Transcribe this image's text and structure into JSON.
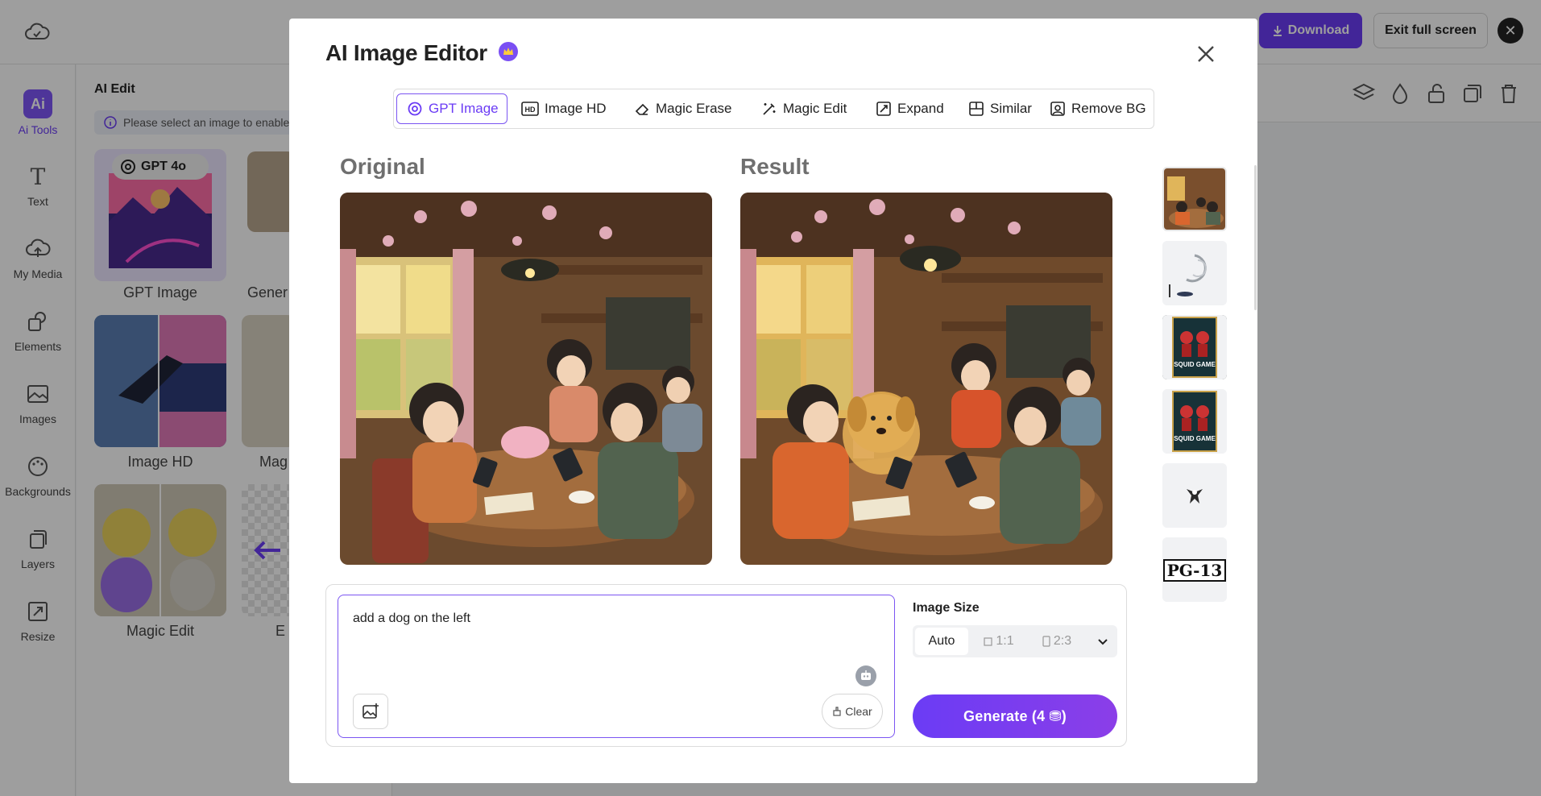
{
  "topbar": {
    "download_label": "Download",
    "exit_label": "Exit full screen"
  },
  "leftnav": {
    "items": [
      {
        "label": "Ai Tools",
        "icon": "ai-tools-icon",
        "active": true
      },
      {
        "label": "Text",
        "icon": "text-icon"
      },
      {
        "label": "My Media",
        "icon": "upload-cloud-icon"
      },
      {
        "label": "Elements",
        "icon": "elements-icon"
      },
      {
        "label": "Images",
        "icon": "image-icon"
      },
      {
        "label": "Backgrounds",
        "icon": "palette-icon"
      },
      {
        "label": "Layers",
        "icon": "layers-icon"
      },
      {
        "label": "Resize",
        "icon": "resize-icon"
      }
    ],
    "ai_badge": "Ai"
  },
  "panel": {
    "title": "AI Edit",
    "info": "Please select an image to enable",
    "gpt_badge": "GPT 4o",
    "tools": [
      {
        "label": "GPT Image"
      },
      {
        "label": "Gener"
      },
      {
        "label": "Image HD"
      },
      {
        "label": "Mag"
      },
      {
        "label": "Magic Edit"
      },
      {
        "label": "E"
      }
    ]
  },
  "modal": {
    "title": "AI Image Editor",
    "tabs": [
      {
        "label": "GPT Image",
        "icon": "openai-icon",
        "active": true
      },
      {
        "label": "Image HD",
        "icon": "hd-icon"
      },
      {
        "label": "Magic Erase",
        "icon": "eraser-icon"
      },
      {
        "label": "Magic Edit",
        "icon": "magic-wand-icon"
      },
      {
        "label": "Expand",
        "icon": "expand-icon"
      },
      {
        "label": "Similar",
        "icon": "similar-icon"
      },
      {
        "label": "Remove BG",
        "icon": "remove-bg-icon"
      }
    ],
    "original_title": "Original",
    "result_title": "Result",
    "thumbnails": [
      "cafe-scene",
      "abstract-sketch",
      "squid-game-poster",
      "squid-game-poster",
      "small-figure",
      "pg-13-logo"
    ],
    "pg13_text": "PG-13",
    "squid_text": "SQUID GAME",
    "prompt": {
      "value": "add a dog on the left"
    },
    "clear_label": "Clear",
    "image_size_label": "Image Size",
    "sizes": [
      {
        "label": "Auto",
        "active": true
      },
      {
        "label": "1:1"
      },
      {
        "label": "2:3"
      }
    ],
    "generate_label": "Generate  (4 ⛃)"
  },
  "colors": {
    "accent": "#6b3cf5",
    "accent_light": "#7b55f2"
  }
}
